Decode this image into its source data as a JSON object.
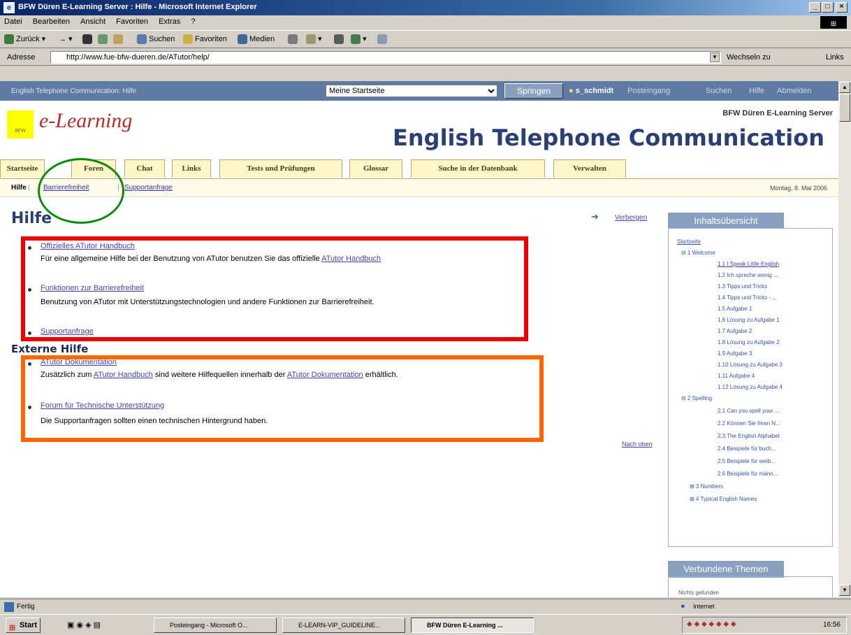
{
  "window": {
    "title": "BFW Düren E-Learning Server : Hilfe - Microsoft Internet Explorer",
    "min": "_",
    "max": "□",
    "close": "×"
  },
  "menu": [
    "Datei",
    "Bearbeiten",
    "Ansicht",
    "Favoriten",
    "Extras",
    "?"
  ],
  "toolbar": {
    "back": "Zurück",
    "search": "Suchen",
    "favorites": "Favoriten",
    "media": "Medien"
  },
  "address": {
    "label": "Adresse",
    "url": "http://www.fue-bfw-dueren.de/ATutor/help/",
    "go": "Wechseln zu",
    "links": "Links"
  },
  "topnav": {
    "course": "English Telephone Communication: Hilfe",
    "select": "Meine Startseite",
    "jump": "Springen",
    "user": "s_schmidt",
    "links": [
      "Posteingang",
      "Suchen",
      "Hilfe",
      "Abmelden"
    ]
  },
  "logo": {
    "small": "BFW",
    "text": "e-Learning"
  },
  "server": "BFW Düren E-Learning Server",
  "course_title": "English Telephone Communication",
  "tabs": [
    "Startseite",
    "Foren",
    "Chat",
    "Links",
    "Tests und Prüfungen",
    "Glossar",
    "Suche in der Datenbank",
    "Verwalten"
  ],
  "subnav": {
    "current": "Hilfe",
    "links": [
      "Barrierefreiheit",
      "Supportanfrage"
    ],
    "date": "Montag, 8. Mai 2006"
  },
  "help_title": "Hilfe",
  "help_items": [
    {
      "link": "Offizielles ATutor Handbuch",
      "desc": "Für eine allgemeine Hilfe bei der Benutzung von ATutor benutzen Sie das offizielle",
      "desc_link": "ATutor Handbuch"
    },
    {
      "link": "Funktionen zur Barrierefreiheit",
      "desc": "Benutzung von ATutor mit Unterstützungstechnologien und andere Funktionen zur Barrierefreiheit."
    },
    {
      "link": "Supportanfrage"
    }
  ],
  "external_title": "Externe Hilfe",
  "external_items": [
    {
      "link": "ATutor Dokumentation",
      "desc1": "Zusätzlich zum",
      "l1": "ATutor Handbuch",
      "desc2": "sind weitere Hilfequellen innerhalb der",
      "l2": "ATutor Dokumentation",
      "desc3": "erhältlich."
    },
    {
      "link": "Forum für Technische Unterstützung",
      "desc": "Die Supportanfragen sollten einen technischen Hintergrund haben."
    }
  ],
  "sidebar": {
    "hide": "Verbergen",
    "toc_title": "Inhaltsübersicht",
    "to_top": "Nach oben",
    "related_title": "Verbundene Themen",
    "related_empty": "Nichts gefunden",
    "toc": [
      "Startseite",
      "⊟ 1 Welcome",
      "1.1 I Speak Little English",
      "1.2 Ich spreche wenig ...",
      "1.3 Tipps und Tricks",
      "1.4 Tipps und Tricks - ...",
      "1.5 Aufgabe 1",
      "1.6 Lösung zu Aufgabe 1",
      "1.7 Aufgabe 2",
      "1.8 Lösung zu Aufgabe 2",
      "1.9 Aufgabe 3",
      "1.10 Lösung zu Aufgabe 3",
      "1.11 Aufgabe 4",
      "1.12 Lösung zu Aufgabe 4",
      "⊟ 2 Spelling",
      "2.1 Can you spell your ...",
      "2.2 Können Sie Ihren N...",
      "2.3 The English Alphabet",
      "2.4 Beispiele für buch...",
      "2.5 Beispiele für weib...",
      "2.6 Beispiele für männ...",
      "⊞ 3 Numbers",
      "⊞ 4 Typical English Names"
    ]
  },
  "status": {
    "text": "Fertig",
    "zone": "Internet"
  },
  "taskbar": {
    "start": "Start",
    "items": [
      "Posteingang - Microsoft O...",
      "E-LEARN-VIP_GUIDELINE...",
      "BFW Düren E-Learning ..."
    ],
    "time": "16:56"
  }
}
